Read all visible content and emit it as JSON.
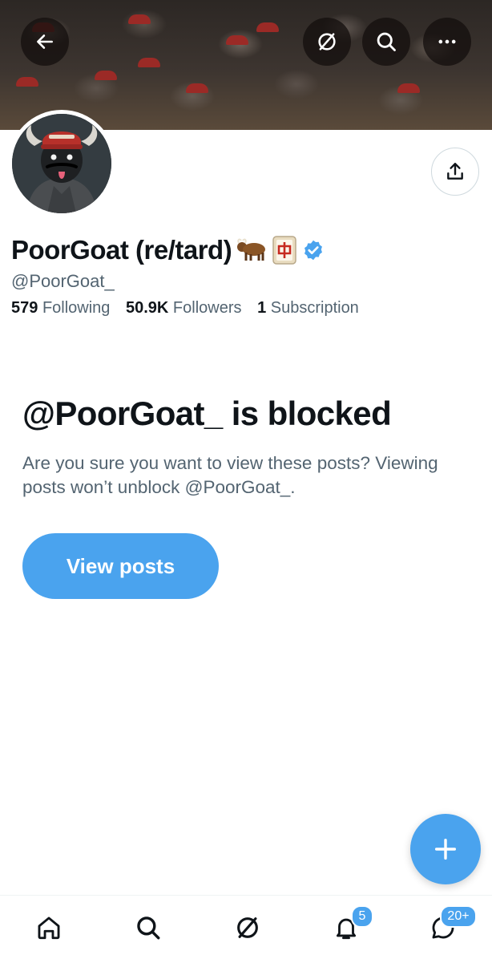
{
  "profile": {
    "display_name": "PoorGoat (re/tard)",
    "handle": "@PoorGoat_",
    "verified": true
  },
  "stats": {
    "following_count": "579",
    "following_label": "Following",
    "followers_count": "50.9K",
    "followers_label": "Followers",
    "subscriptions_count": "1",
    "subscriptions_label": "Subscription"
  },
  "blocked": {
    "title": "@PoorGoat_ is blocked",
    "description": "Are you sure you want to view these posts? Viewing posts won’t unblock @PoorGoat_.",
    "button_label": "View posts"
  },
  "tabbar": {
    "notifications_badge": "5",
    "messages_badge": "20+"
  },
  "colors": {
    "accent": "#4aa3ee",
    "text": "#0f1419",
    "secondary_text": "#536471"
  },
  "icons": {
    "top_bar": [
      "back-arrow-icon",
      "grok-icon",
      "search-icon",
      "more-icon"
    ],
    "profile": [
      "share-icon",
      "ox-emoji-icon",
      "mahjong-red-dragon-icon",
      "verified-badge-icon"
    ],
    "tabbar": [
      "home-icon",
      "search-icon",
      "grok-icon",
      "notifications-icon",
      "messages-icon"
    ],
    "fab": "plus-icon"
  }
}
